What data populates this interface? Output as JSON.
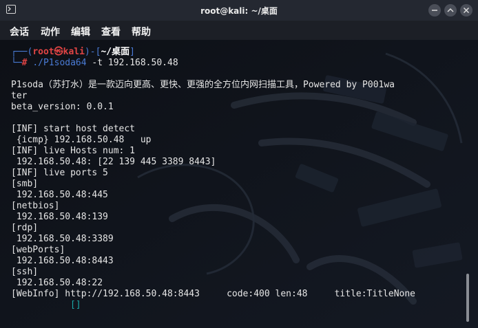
{
  "window": {
    "title": "root@kali: ~/桌面"
  },
  "menu": {
    "items": [
      "会话",
      "动作",
      "编辑",
      "查看",
      "帮助"
    ]
  },
  "prompt": {
    "corner_top": "┌──(",
    "user": "root",
    "skull": "㉿",
    "host": "kali",
    "mid": ")-[",
    "path": "~/桌面",
    "end": "]",
    "corner_bottom": "└─",
    "hash": "#",
    "command_bin": "./P1soda64",
    "command_args": " -t 192.168.50.48"
  },
  "output": {
    "line1": "P1soda（苏打水）是一款迈向更高、更快、更强的全方位内网扫描工具，Powered by P001wa",
    "line2": "ter",
    "line3": "beta_version: 0.0.1",
    "line4": "",
    "line5": "[INF] start host detect",
    "line6": " {icmp} 192.168.50.48   up",
    "line7": "[INF] live Hosts num: 1",
    "line8": " 192.168.50.48: [22 139 445 3389 8443]",
    "line9": "[INF] live ports 5",
    "line10": "[smb]",
    "line11": " 192.168.50.48:445",
    "line12": "[netbios]",
    "line13": " 192.168.50.48:139",
    "line14": "[rdp]",
    "line15": " 192.168.50.48:3389",
    "line16": "[webPorts]",
    "line17": " 192.168.50.48:8443",
    "line18": "[ssh]",
    "line19": " 192.168.50.48:22",
    "line20": "[WebInfo] http://192.168.50.48:8443     code:400 len:48     title:TitleNone",
    "line21": "[]"
  },
  "icons": {
    "app": "terminal-icon",
    "min": "minimize-icon",
    "max": "maximize-icon",
    "close": "close-icon"
  },
  "colors": {
    "titlebar": "#242831",
    "terminal_bg": "#0e1117",
    "prompt_red": "#e04444",
    "prompt_blue": "#4a7bd6",
    "cursor_cyan": "#1aa6a6"
  }
}
